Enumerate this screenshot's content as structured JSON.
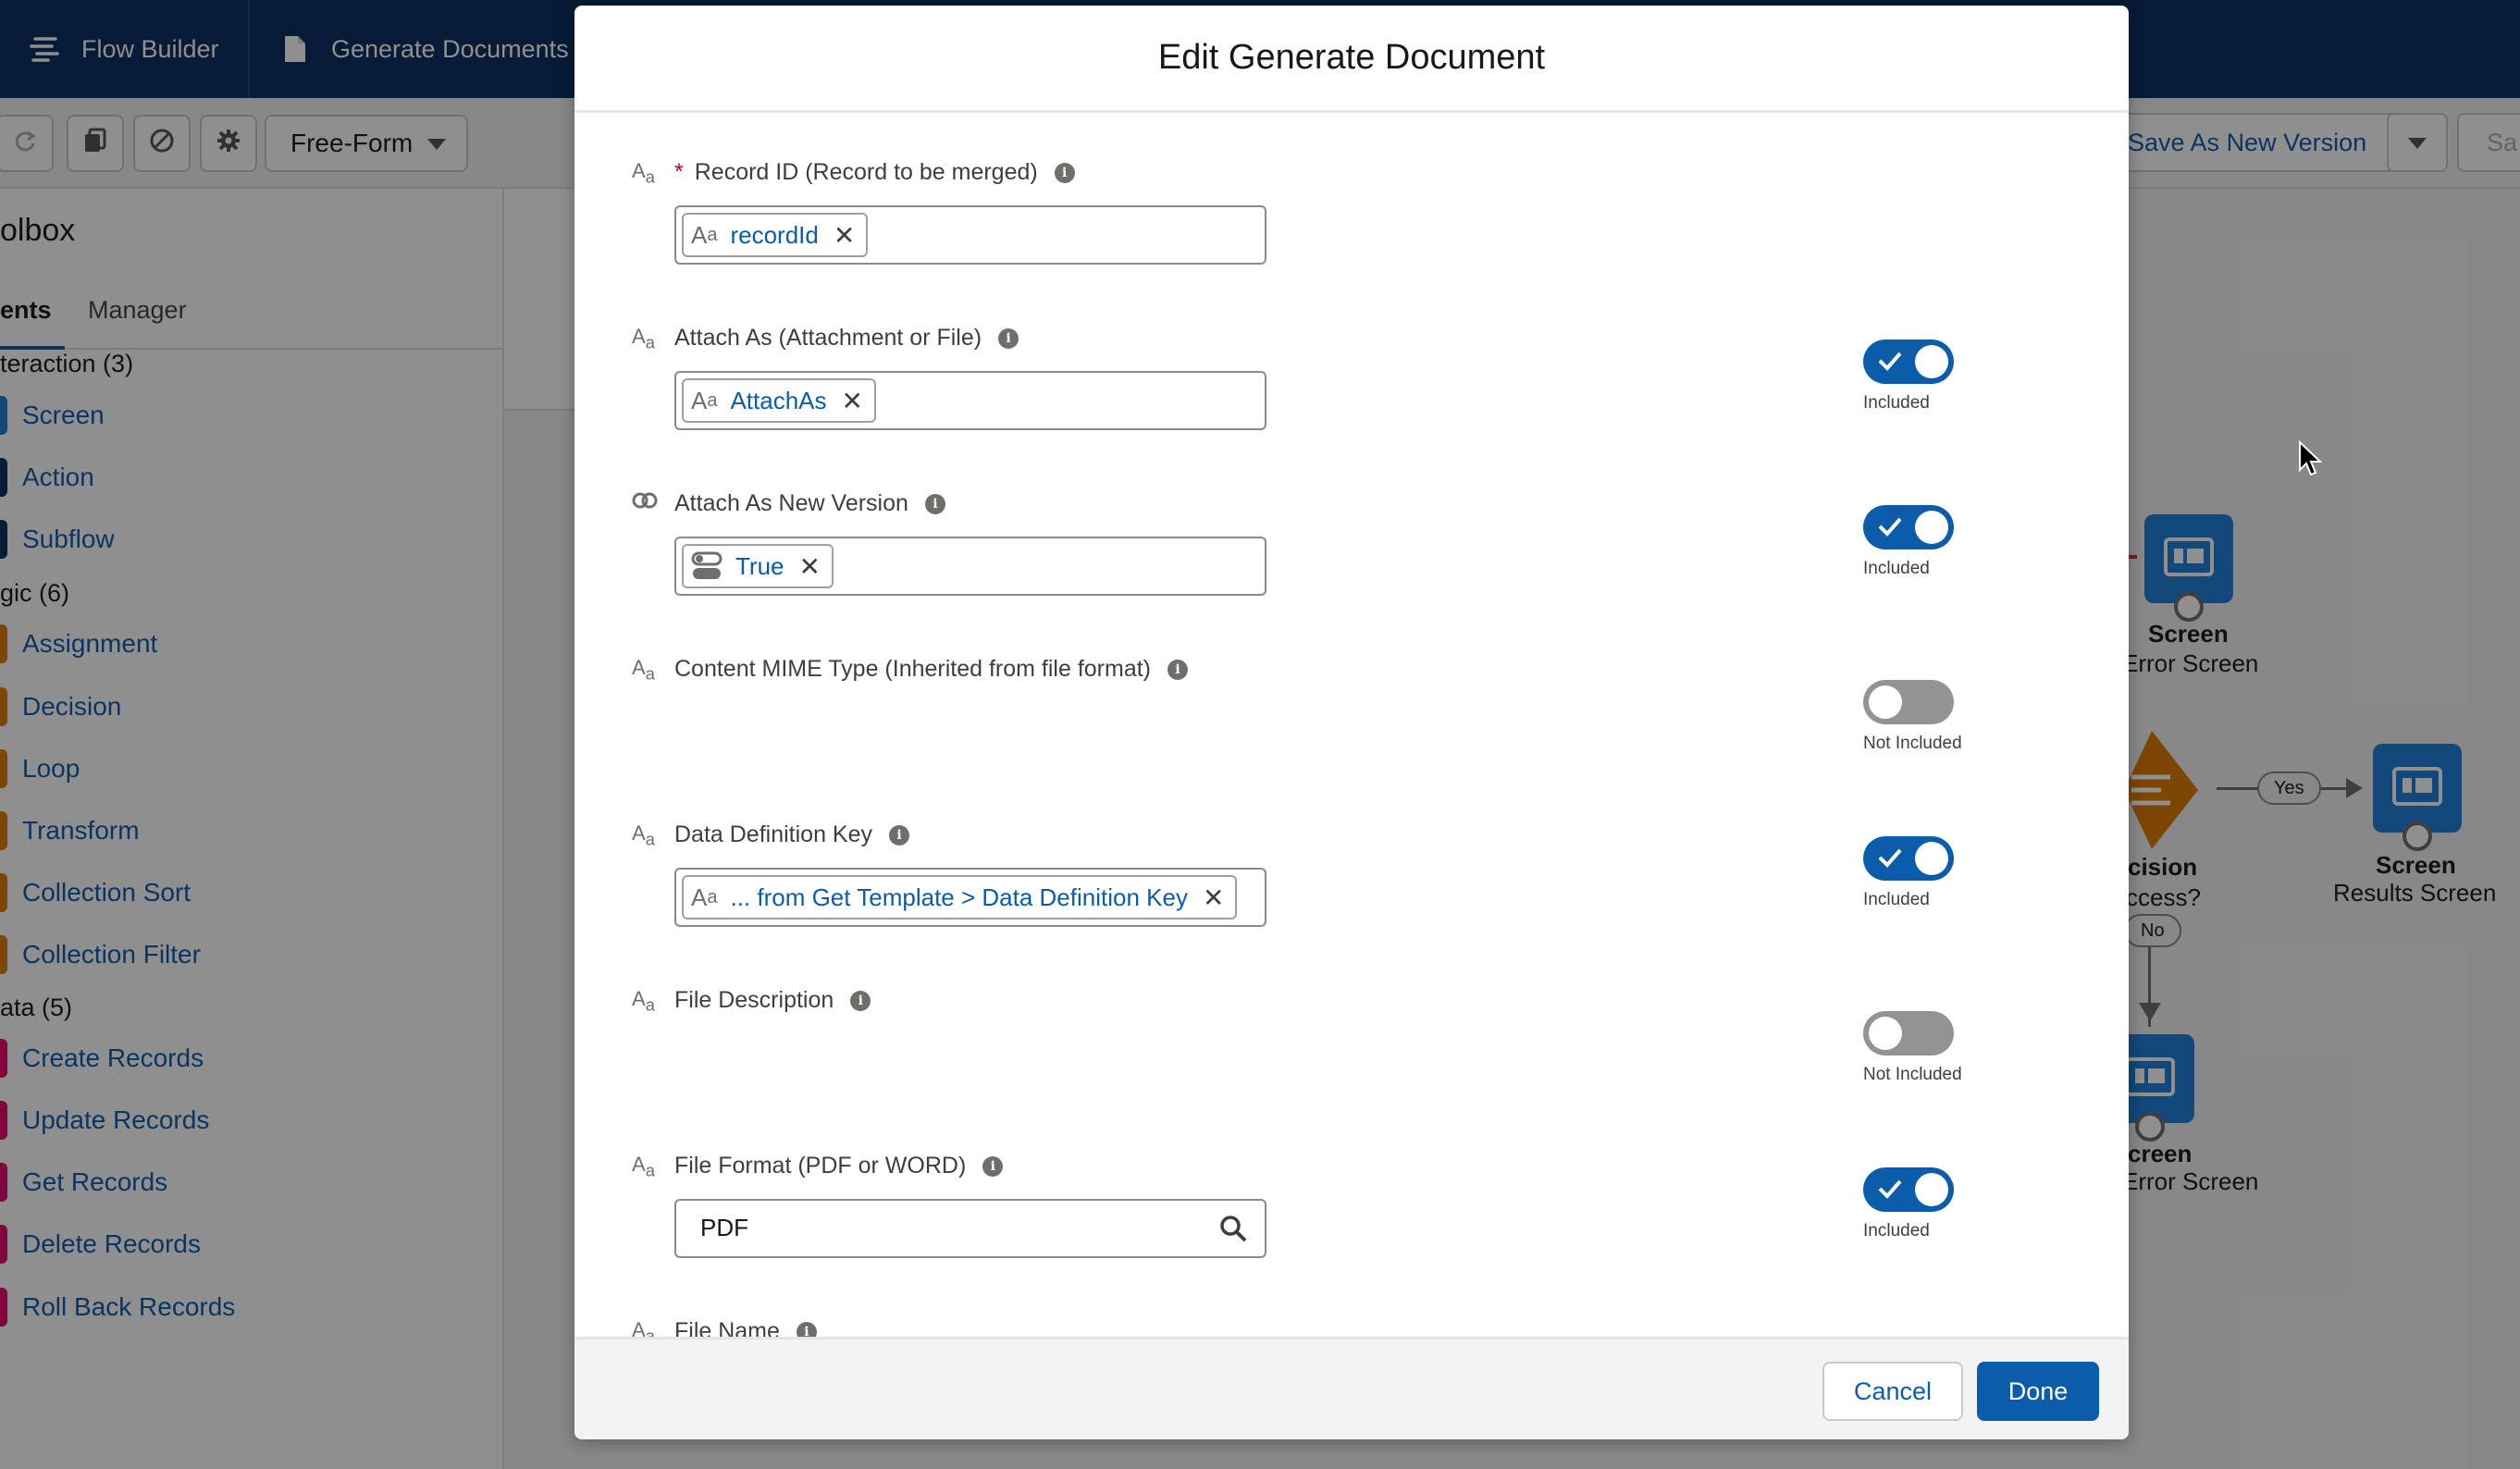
{
  "app": {
    "tabs": [
      {
        "label": "Flow Builder",
        "icon": "flow-builder-icon"
      },
      {
        "label": "Generate Documents",
        "icon": "document-icon"
      }
    ],
    "toolbar": {
      "layout_select": "Free-Form",
      "save_as_new_version": "Save As New Version",
      "save_partial": "Sa"
    },
    "toolbox": {
      "title": "olbox",
      "tab_elements": "ents",
      "tab_manager": "Manager",
      "sections": [
        {
          "label": "teraction (3)",
          "items": [
            {
              "label": "Screen",
              "color": "#1b7fd9"
            },
            {
              "label": "Action",
              "color": "#032d60"
            },
            {
              "label": "Subflow",
              "color": "#032d60"
            }
          ]
        },
        {
          "label": "gic (6)",
          "items": [
            {
              "label": "Assignment",
              "color": "#dd7a01"
            },
            {
              "label": "Decision",
              "color": "#dd7a01"
            },
            {
              "label": "Loop",
              "color": "#dd7a01"
            },
            {
              "label": "Transform",
              "color": "#dd7a01"
            },
            {
              "label": "Collection Sort",
              "color": "#dd7a01"
            },
            {
              "label": "Collection Filter",
              "color": "#dd7a01"
            }
          ]
        },
        {
          "label": "ata (5)",
          "items": [
            {
              "label": "Create Records",
              "color": "#e3066a"
            },
            {
              "label": "Update Records",
              "color": "#e3066a"
            },
            {
              "label": "Get Records",
              "color": "#e3066a"
            },
            {
              "label": "Delete Records",
              "color": "#e3066a"
            },
            {
              "label": "Roll Back Records",
              "color": "#e3066a"
            }
          ]
        }
      ]
    },
    "canvas": {
      "node1_title": "Screen",
      "node1_sub": "Error Screen",
      "decision_title": "cision",
      "decision_sub": "ccess?",
      "yes_label": "Yes",
      "no_label": "No",
      "node2_title": "Screen",
      "node2_sub": "Results Screen",
      "node3_title": "creen",
      "node3_sub": "Error Screen"
    }
  },
  "modal": {
    "title": "Edit Generate Document",
    "fields": [
      {
        "label": "Record ID (Record to be merged)",
        "required": true,
        "type_icon": "text-type-icon",
        "value_pill": "recordId",
        "toggle": null,
        "toggle_label": ""
      },
      {
        "label": "Attach As (Attachment or File)",
        "required": false,
        "type_icon": "text-type-icon",
        "value_pill": "AttachAs",
        "toggle": true,
        "toggle_label": "Included"
      },
      {
        "label": "Attach As New Version",
        "required": false,
        "type_icon": "boolean-type-icon",
        "value_pill": "True",
        "toggle": true,
        "toggle_label": "Included"
      },
      {
        "label": "Content MIME Type (Inherited from file format)",
        "required": false,
        "type_icon": "text-type-icon",
        "value_pill": "",
        "toggle": false,
        "toggle_label": "Not Included"
      },
      {
        "label": "Data Definition Key",
        "required": false,
        "type_icon": "text-type-icon",
        "value_pill": "... from Get Template > Data Definition Key",
        "toggle": true,
        "toggle_label": "Included"
      },
      {
        "label": "File Description",
        "required": false,
        "type_icon": "text-type-icon",
        "value_pill": "",
        "toggle": false,
        "toggle_label": "Not Included"
      },
      {
        "label": "File Format (PDF or WORD)",
        "required": false,
        "type_icon": "text-type-icon",
        "value_text": "PDF",
        "toggle": true,
        "toggle_label": "Included"
      },
      {
        "label": "File Name",
        "required": false,
        "type_icon": "text-type-icon"
      }
    ],
    "cancel": "Cancel",
    "done": "Done"
  },
  "colors": {
    "brand": "#0b5cab",
    "header": "#032d60"
  }
}
